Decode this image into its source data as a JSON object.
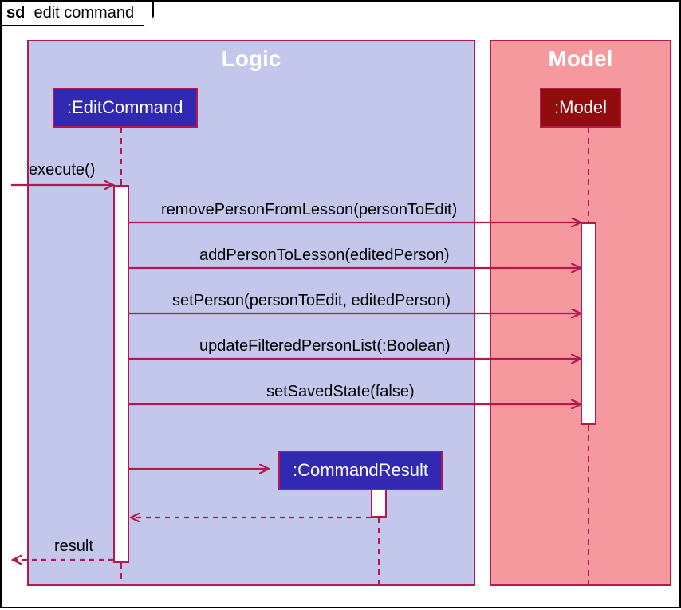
{
  "frame": {
    "type_label": "sd",
    "title": "edit command"
  },
  "regions": {
    "logic": "Logic",
    "model": "Model"
  },
  "lifelines": {
    "edit_command": ":EditCommand",
    "model": ":Model",
    "command_result": ":CommandResult"
  },
  "messages": {
    "execute": "execute()",
    "m1": "removePersonFromLesson(personToEdit)",
    "m2": "addPersonToLesson(editedPerson)",
    "m3": "setPerson(personToEdit, editedPerson)",
    "m4": "updateFilteredPersonList(:Boolean)",
    "m5": "setSavedState(false)",
    "result": "result"
  },
  "colors": {
    "logic_bg": "#c3c7eb",
    "model_bg": "#f5999f",
    "line": "#b3184f",
    "blue": "#3229b2",
    "darkred": "#910c0c"
  },
  "chart_data": {
    "type": "sequence_diagram",
    "frame": "sd edit command",
    "participants": [
      {
        "name": ":EditCommand",
        "group": "Logic"
      },
      {
        "name": ":CommandResult",
        "group": "Logic",
        "created": true
      },
      {
        "name": ":Model",
        "group": "Model"
      }
    ],
    "messages": [
      {
        "from": "caller",
        "to": ":EditCommand",
        "label": "execute()",
        "type": "sync"
      },
      {
        "from": ":EditCommand",
        "to": ":Model",
        "label": "removePersonFromLesson(personToEdit)",
        "type": "sync"
      },
      {
        "from": ":EditCommand",
        "to": ":Model",
        "label": "addPersonToLesson(editedPerson)",
        "type": "sync"
      },
      {
        "from": ":EditCommand",
        "to": ":Model",
        "label": "setPerson(personToEdit, editedPerson)",
        "type": "sync"
      },
      {
        "from": ":EditCommand",
        "to": ":Model",
        "label": "updateFilteredPersonList(:Boolean)",
        "type": "sync"
      },
      {
        "from": ":EditCommand",
        "to": ":Model",
        "label": "setSavedState(false)",
        "type": "sync"
      },
      {
        "from": ":EditCommand",
        "to": ":CommandResult",
        "label": "",
        "type": "create"
      },
      {
        "from": ":CommandResult",
        "to": ":EditCommand",
        "label": "",
        "type": "return"
      },
      {
        "from": ":EditCommand",
        "to": "caller",
        "label": "result",
        "type": "return"
      }
    ]
  }
}
